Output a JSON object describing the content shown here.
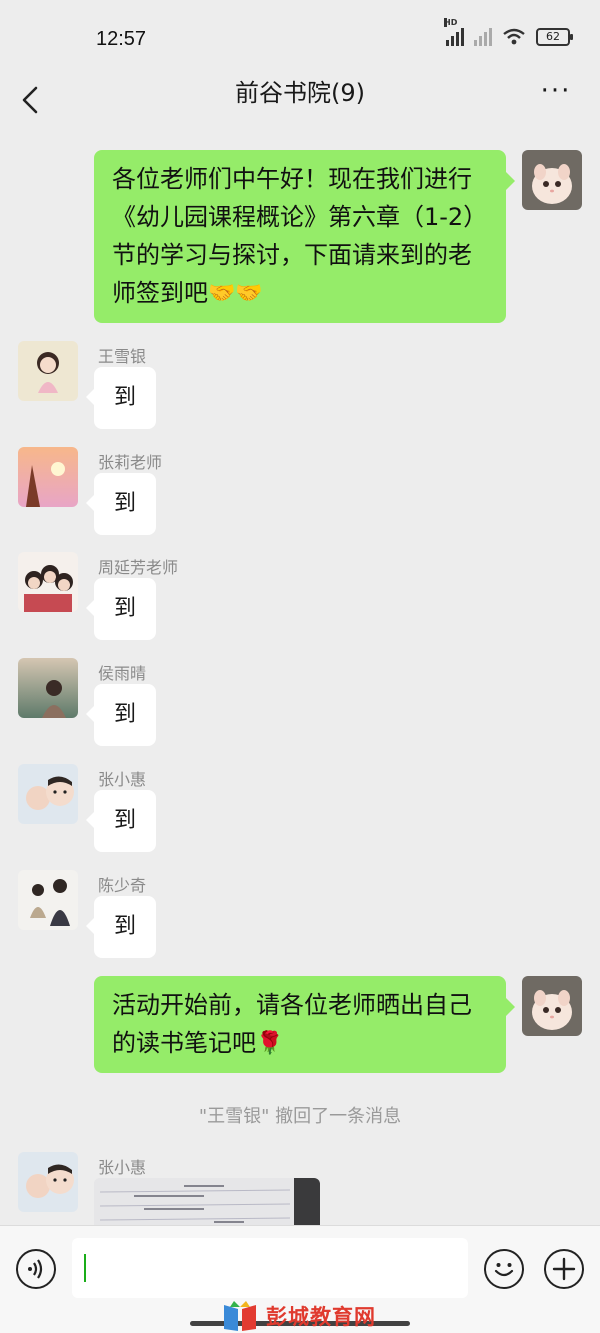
{
  "status": {
    "time": "12:57",
    "battery": "62",
    "signal_label": "HD"
  },
  "header": {
    "title": "前谷书院(9)",
    "more": "···"
  },
  "messages": {
    "m1": {
      "text": "各位老师们中午好！现在我们进行《幼儿园课程概论》第六章（1-2）节的学习与探讨，下面请来到的老师签到吧",
      "emoji": "🤝🤝"
    },
    "m2": {
      "sender": "王雪银",
      "text": "到"
    },
    "m3": {
      "sender": "张莉老师",
      "text": "到"
    },
    "m4": {
      "sender": "周延芳老师",
      "text": "到"
    },
    "m5": {
      "sender": "侯雨晴",
      "text": "到"
    },
    "m6": {
      "sender": "张小惠",
      "text": "到"
    },
    "m7": {
      "sender": "陈少奇",
      "text": "到"
    },
    "m8": {
      "text": "活动开始前，请各位老师晒出自己的读书笔记吧",
      "emoji": "🌹"
    },
    "sys": "\"王雪银\" 撤回了一条消息",
    "m9": {
      "sender": "张小惠",
      "image": "reading-notes-photo"
    }
  },
  "input": {
    "placeholder": ""
  },
  "watermark": "彭城教育网",
  "colors": {
    "sent_bubble": "#95ec69",
    "received_bubble": "#ffffff",
    "background": "#ededed",
    "watermark": "#e03a2e"
  }
}
